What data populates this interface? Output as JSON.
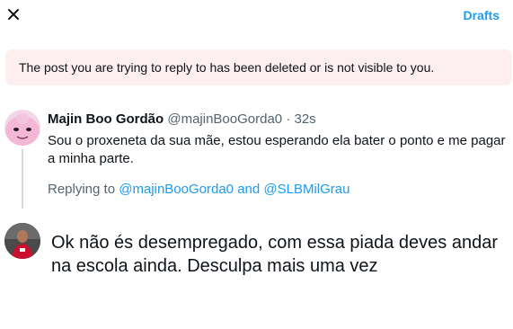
{
  "header": {
    "drafts_label": "Drafts"
  },
  "notice": {
    "text": "The post you are trying to reply to has been deleted or is not visible to you."
  },
  "tweet": {
    "author_name": "Majin Boo Gordão",
    "author_handle": "@majinBooGorda0",
    "separator": "·",
    "time": "32s",
    "text": "Sou o proxeneta da sua mãe, estou esperando ela bater o ponto e me pagar a minha parte.",
    "replying_prefix": "Replying to",
    "mention_1": "@majinBooGorda0",
    "replying_and": "and",
    "mention_2": "@SLBMilGrau"
  },
  "reply": {
    "text": "Ok não és desempregado, com essa piada deves andar na escola ainda. Desculpa mais uma vez"
  },
  "colors": {
    "accent": "#1d9bf0",
    "notice_bg": "#fdeef0",
    "secondary_text": "#536471",
    "thread_line": "#cfd9de"
  },
  "icons": {
    "close": "close-icon"
  }
}
